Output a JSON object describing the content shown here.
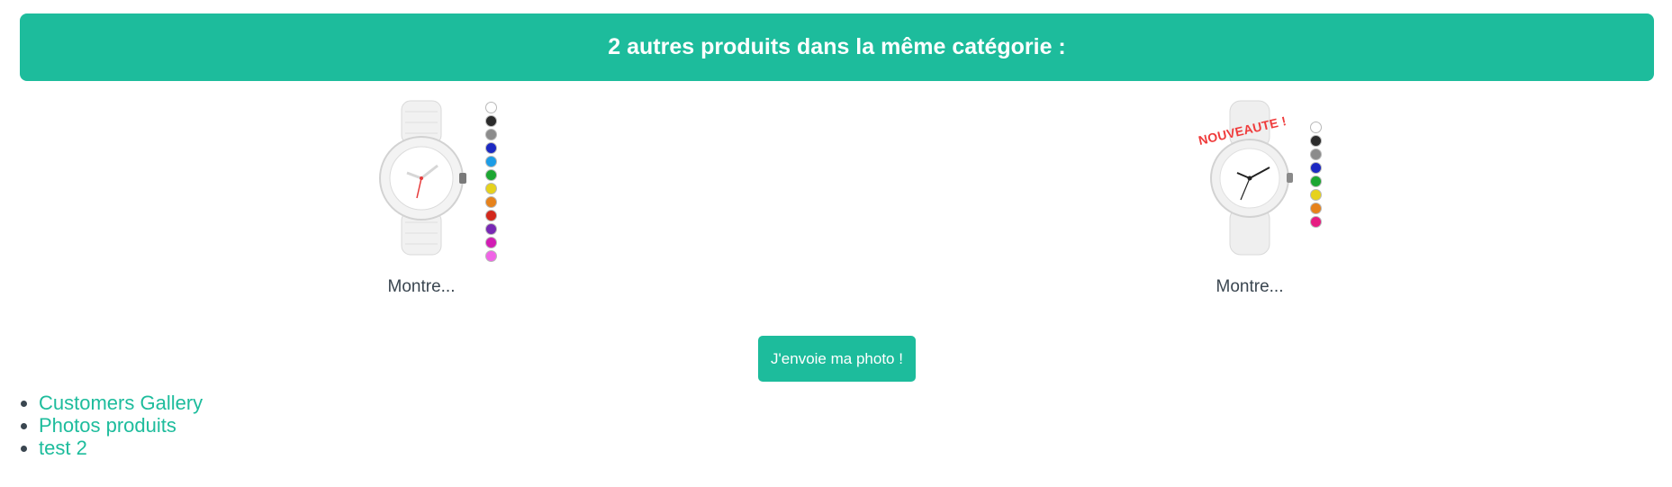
{
  "banner": {
    "title": "2 autres produits dans la même catégorie :"
  },
  "products": [
    {
      "name": "Montre...",
      "swatches": [
        "#ffffff",
        "#2b2b2b",
        "#8c8c8c",
        "#1c28c2",
        "#1c9ce6",
        "#1ca632",
        "#e6d21c",
        "#e6821c",
        "#d2281c",
        "#7828b4",
        "#d21cb4",
        "#f064e6"
      ]
    },
    {
      "name": "Montre...",
      "badge": "NOUVEAUTE !",
      "swatches": [
        "#ffffff",
        "#2b2b2b",
        "#8c8c8c",
        "#1c28c2",
        "#1ca632",
        "#e6d21c",
        "#e6821c",
        "#e61c82"
      ]
    }
  ],
  "photo_button": {
    "label": "J'envoie ma photo !"
  },
  "links": [
    {
      "label": "Customers Gallery"
    },
    {
      "label": "Photos produits"
    },
    {
      "label": "test 2"
    }
  ]
}
